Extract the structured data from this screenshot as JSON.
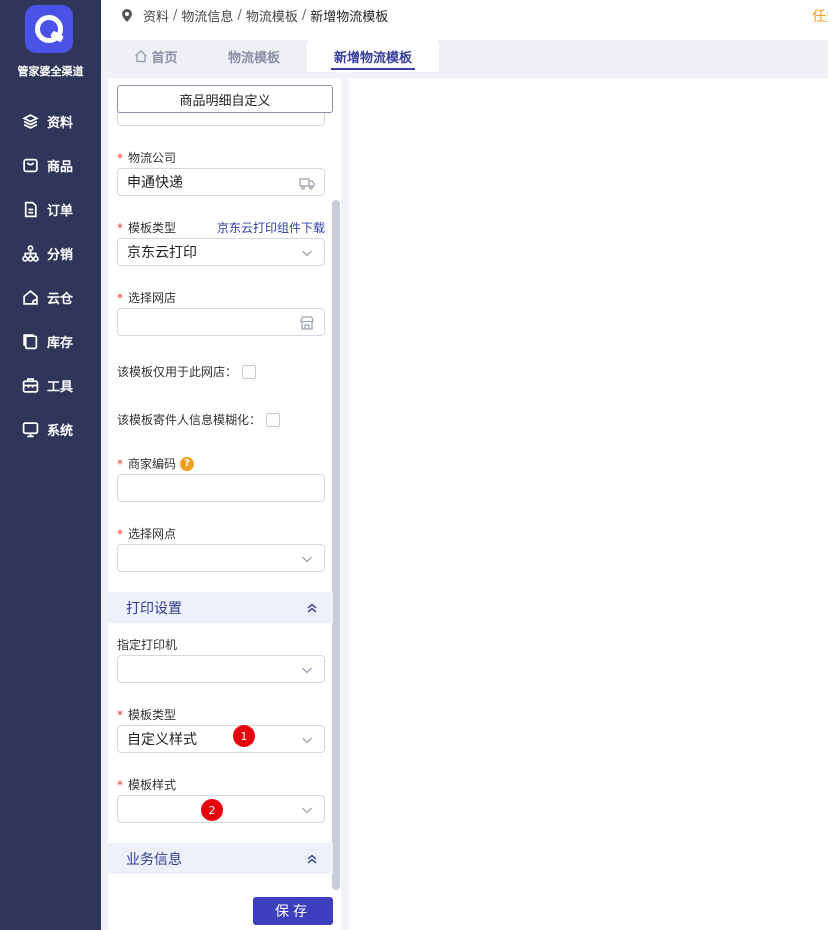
{
  "sidebar": {
    "brand": "管家婆全渠道",
    "items": [
      {
        "label": "资料",
        "icon": "layers-icon"
      },
      {
        "label": "商品",
        "icon": "bag-icon"
      },
      {
        "label": "订单",
        "icon": "document-icon"
      },
      {
        "label": "分销",
        "icon": "network-icon"
      },
      {
        "label": "云仓",
        "icon": "cloud-warehouse-icon"
      },
      {
        "label": "库存",
        "icon": "inventory-icon"
      },
      {
        "label": "工具",
        "icon": "toolbox-icon"
      },
      {
        "label": "系统",
        "icon": "monitor-icon"
      }
    ]
  },
  "header": {
    "breadcrumb": [
      "资料",
      "物流信息",
      "物流模板",
      "新增物流模板"
    ],
    "right_link": "任务"
  },
  "tabs": [
    {
      "label": "首页",
      "icon": "home-icon"
    },
    {
      "label": "物流模板"
    },
    {
      "label": "新增物流模板",
      "active": true
    }
  ],
  "form": {
    "top_button": "商品明细自定义",
    "logistics_company": {
      "label": "物流公司",
      "value": "申通快递",
      "icon": "truck-icon"
    },
    "template_type": {
      "label": "模板类型",
      "value": "京东云打印",
      "link": "京东云打印组件下载"
    },
    "select_shop": {
      "label": "选择网店",
      "value": "",
      "icon": "shop-icon"
    },
    "only_this_shop": {
      "label": "该模板仅用于此网店：",
      "checked": false
    },
    "blur_sender": {
      "label": "该模板寄件人信息模糊化：",
      "checked": false
    },
    "merchant_code": {
      "label": "商家编码",
      "value": "",
      "help": "?"
    },
    "select_outlet": {
      "label": "选择网点",
      "value": ""
    },
    "print_section": {
      "title": "打印设置"
    },
    "printer": {
      "label": "指定打印机",
      "value": ""
    },
    "print_template_type": {
      "label": "模板类型",
      "value": "自定义样式",
      "badge": "1"
    },
    "template_style": {
      "label": "模板样式",
      "value": "",
      "badge": "2"
    },
    "business_section": {
      "title": "业务信息"
    },
    "save": "保存"
  }
}
